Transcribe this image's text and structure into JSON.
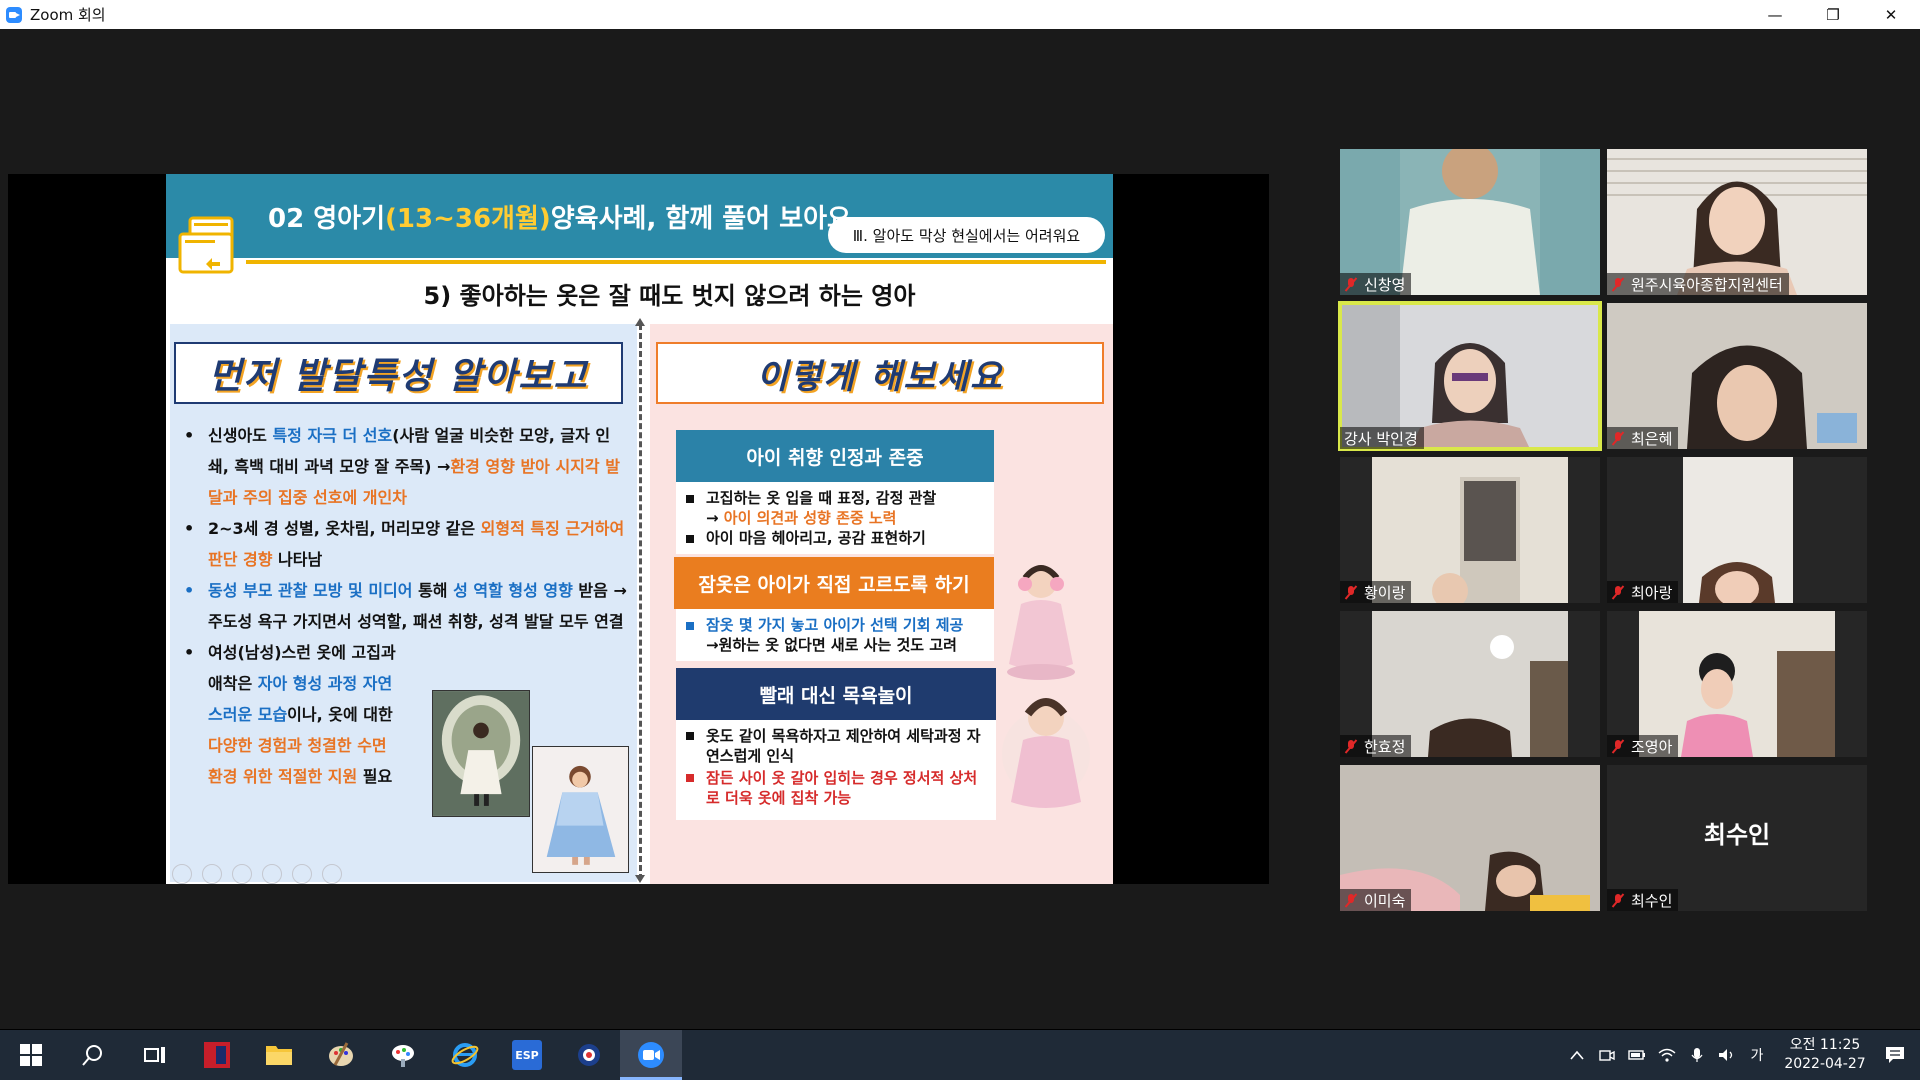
{
  "window": {
    "title": "Zoom 회의",
    "controls": [
      "—",
      "❐",
      "✕"
    ]
  },
  "slide": {
    "header_title_a": "02 영아기",
    "header_title_b": "(13~36개월)",
    "header_title_c": "양육사례, 함께 풀어 보아요",
    "section_pill": "Ⅲ. 알아도 막상 현실에서는 어려워요",
    "subtitle": "5) 좋아하는 옷은 잘 때도 벗지 않으려 하는 영아",
    "left_heading": "먼저 발달특성 알아보고",
    "right_heading": "이렇게 해보세요",
    "bullets": {
      "b1_a": "신생아도 ",
      "b1_b": "특정 자극 더 선호",
      "b1_c": "(사람 얼굴 비슷한 모양, 글자 인쇄, 흑백 대비 과녁 모양 잘 주목) →",
      "b1_d": "환경 영향 받아 시지각 발달과 주의 집중 선호에 개인차",
      "b2_a": "2~3세 경 성별, 옷차림, 머리모양 같은 ",
      "b2_b": "외형적 특징 근거하여 판단 경향",
      "b2_c": " 나타남",
      "b3_a": "동성 부모 관찰 모방 및 미디어",
      "b3_b": " 통해 ",
      "b3_c": "성 역할 형성 영향",
      "b3_d": " 받음 → 주도성 욕구 가지면서 성역할, 패션 취향, 성격 발달 모두 연결",
      "b4_a": "여성(남성)스런 옷에 고집과 애착은 ",
      "b4_b": "자아 형성 과정 자연스러운 모습",
      "b4_c": "이나, 옷에 대한 ",
      "b4_d": "다양한 경험과 청결한 수면 환경 위한 적절한 지원",
      "b4_e": " 필요"
    },
    "box1": {
      "title": "아이 취향 인정과 존중",
      "line1": "고집하는 옷 입을 때 표정, 감정 관찰",
      "line2_arrow": "→ ",
      "line2": "아이 의견과 성향 존중 노력",
      "line3": "아이 마음 헤아리고, 공감 표현하기"
    },
    "box2": {
      "title": "잠옷은 아이가 직접 고르도록 하기",
      "line1": "잠옷 몇 가지 놓고 아이가 선택 기회 제공",
      "line2": "→원하는 옷 없다면 새로 사는 것도 고려"
    },
    "box3": {
      "title": "빨래 대신 목욕놀이",
      "line1": "옷도 같이 목욕하자고 제안하여 세탁과정 자연스럽게 인식",
      "line2": "잠든 사이 옷 갈아 입히는 경우 정서적 상처로 더욱 옷에 집착 가능"
    }
  },
  "participants": [
    {
      "name": "신창영"
    },
    {
      "name": "원주시육아종합지원센터"
    },
    {
      "name": "강사 박인경"
    },
    {
      "name": "최은혜"
    },
    {
      "name": "황이랑"
    },
    {
      "name": "최아랑"
    },
    {
      "name": "한효정"
    },
    {
      "name": "조영아"
    },
    {
      "name": "이미숙"
    },
    {
      "name": "최수인",
      "display_name": "최수인"
    }
  ],
  "taskbar": {
    "clock_time": "오전 11:25",
    "clock_date": "2022-04-27",
    "ime": "가",
    "esp_label": "ESP"
  }
}
